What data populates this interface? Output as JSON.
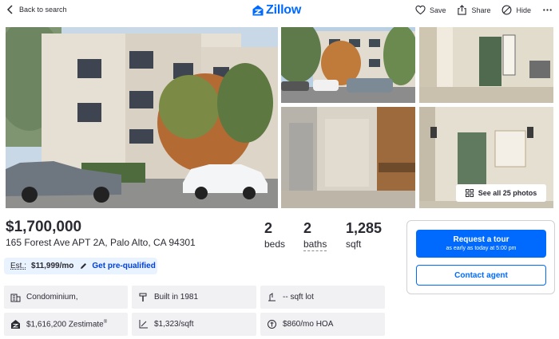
{
  "nav": {
    "back_label": "Back to search",
    "logo_text": "Zillow",
    "save_label": "Save",
    "share_label": "Share",
    "hide_label": "Hide"
  },
  "photos": {
    "see_all_label": "See all 25 photos"
  },
  "listing": {
    "price": "$1,700,000",
    "address": "165 Forest Ave APT 2A, Palo Alto, CA 94301",
    "beds_value": "2",
    "beds_label": "beds",
    "baths_value": "2",
    "baths_label": "baths",
    "sqft_value": "1,285",
    "sqft_label": "sqft"
  },
  "estimate": {
    "label": "Est.:",
    "value": "$11,999/mo",
    "cta": "Get pre-qualified"
  },
  "facts": {
    "type": "Condominium,",
    "built": "Built in 1981",
    "lot": "-- sqft lot",
    "zestimate": "$1,616,200 Zestimate",
    "zestimate_mark": "®",
    "price_per_sqft": "$1,323/sqft",
    "hoa": "$860/mo HOA"
  },
  "contact": {
    "tour_label": "Request a tour",
    "tour_sub": "as early as today at 5:00 pm",
    "agent_label": "Contact agent"
  },
  "colors": {
    "brand": "#006aff",
    "text": "#2a2a33",
    "fact_bg": "#f1f1f4",
    "estimate_bg": "#e9f2ff"
  },
  "icons": [
    "chevron-left-icon",
    "zillow-logo-icon",
    "heart-icon",
    "share-icon",
    "hide-icon",
    "more-icon",
    "grid-icon",
    "pencil-icon",
    "building-icon",
    "hammer-icon",
    "lot-icon",
    "zestimate-icon",
    "ruler-icon",
    "hoa-icon"
  ]
}
